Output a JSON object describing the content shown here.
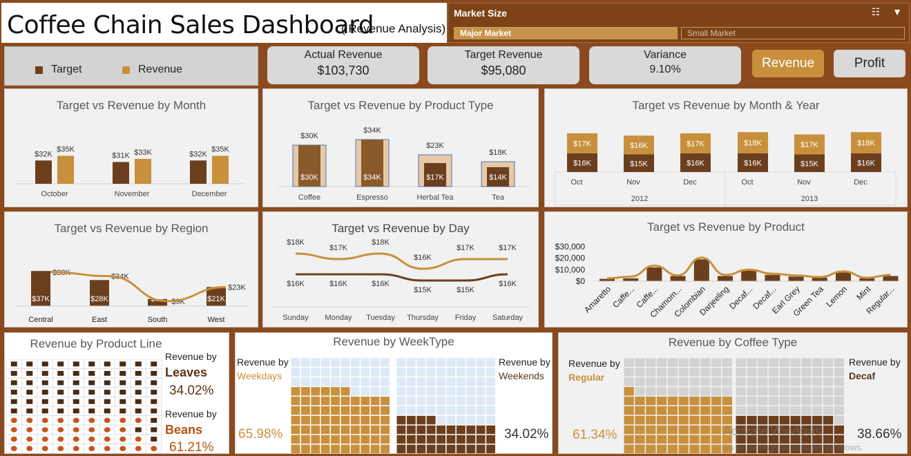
{
  "header": {
    "title": "Coffee Chain Sales Dashboard",
    "subtitle": "( Revenue Analysis)"
  },
  "slicer": {
    "title": "Market Size",
    "options": [
      "Major Market",
      "Small Market"
    ],
    "selected": "Major Market"
  },
  "legend": {
    "target": "Target",
    "revenue": "Revenue"
  },
  "colors": {
    "target": "#6b3f1e",
    "revenue": "#c8903c",
    "frame": "#8a4a1e",
    "panel": "#f1f1f1",
    "empty": "#dde9f5"
  },
  "kpis": [
    {
      "label": "Actual Revenue",
      "value": "$103,730"
    },
    {
      "label": "Target Revenue",
      "value": "$95,080"
    },
    {
      "label": "Variance",
      "value": "9.10%"
    }
  ],
  "buttons": {
    "revenue": "Revenue",
    "profit": "Profit"
  },
  "chart_data": [
    {
      "id": "by_month",
      "type": "bar",
      "title": "Target vs Revenue by Month",
      "categories": [
        "October",
        "November",
        "December"
      ],
      "series": [
        {
          "name": "Target",
          "values": [
            32,
            31,
            32
          ],
          "labels": [
            "$32K",
            "$31K",
            "$32K"
          ]
        },
        {
          "name": "Revenue",
          "values": [
            35,
            33,
            35
          ],
          "labels": [
            "$35K",
            "$33K",
            "$35K"
          ]
        }
      ]
    },
    {
      "id": "by_product_type",
      "type": "bar",
      "title": "Target vs Revenue by Product Type",
      "categories": [
        "Coffee",
        "Espresso",
        "Herbal Tea",
        "Tea"
      ],
      "series": [
        {
          "name": "Target",
          "values": [
            30,
            34,
            17,
            14
          ],
          "labels": [
            "$30K",
            "$34K",
            "$17K",
            "$14K"
          ]
        },
        {
          "name": "Revenue",
          "values": [
            30,
            34,
            23,
            18
          ],
          "labels": [
            "$30K",
            "$34K",
            "$23K",
            "$18K"
          ]
        }
      ]
    },
    {
      "id": "by_month_year",
      "type": "bar",
      "title": "Target vs Revenue by Month & Year",
      "categories": [
        "Oct",
        "Nov",
        "Dec",
        "Oct",
        "Nov",
        "Dec"
      ],
      "groups": [
        "2012",
        "2013"
      ],
      "series": [
        {
          "name": "Target",
          "values": [
            16,
            15,
            16,
            16,
            15,
            16
          ],
          "labels": [
            "$16K",
            "$15K",
            "$16K",
            "$16K",
            "$15K",
            "$16K"
          ]
        },
        {
          "name": "Revenue",
          "values": [
            17,
            16,
            17,
            18,
            17,
            18
          ],
          "labels": [
            "$17K",
            "$16K",
            "$17K",
            "$18K",
            "$17K",
            "$18K"
          ]
        }
      ]
    },
    {
      "id": "by_region",
      "type": "bar",
      "title": "Target vs Revenue by Region",
      "categories": [
        "Central",
        "East",
        "South",
        "West"
      ],
      "series": [
        {
          "name": "Target",
          "values": [
            37,
            28,
            9,
            21
          ],
          "labels": [
            "$37K",
            "$28K",
            "$9K",
            "$21K"
          ]
        },
        {
          "name": "Revenue",
          "values": [
            38,
            34,
            9,
            23
          ],
          "labels": [
            "$38K",
            "$34K",
            "$9K",
            "$23K"
          ]
        }
      ]
    },
    {
      "id": "by_day",
      "type": "line",
      "title": "Target vs Revenue by Day",
      "categories": [
        "Sunday",
        "Monday",
        "Tuesday",
        "Thursday",
        "Friday",
        "Saturday"
      ],
      "series": [
        {
          "name": "Target",
          "values": [
            16,
            16,
            16,
            15,
            15,
            16
          ],
          "labels": [
            "$16K",
            "$16K",
            "$16K",
            "$15K",
            "$15K",
            "$16K"
          ]
        },
        {
          "name": "Revenue",
          "values": [
            18,
            17,
            18,
            16,
            17,
            17
          ],
          "labels": [
            "$18K",
            "$17K",
            "$18K",
            "$16K",
            "$17K",
            "$17K"
          ]
        }
      ]
    },
    {
      "id": "by_product",
      "type": "bar",
      "title": "Target vs Revenue by Product",
      "categories": [
        "Amaretto",
        "Caffe...",
        "Caffe...",
        "Chamom...",
        "Colombian",
        "Darjeeling",
        "Decaf...",
        "Decaf...",
        "Earl Grey",
        "Green Tea",
        "Lemon",
        "Mint",
        "Regular..."
      ],
      "yticks": [
        "$0",
        "$10,000",
        "$20,000",
        "$30,000"
      ],
      "ylim": [
        0,
        30000
      ],
      "series": [
        {
          "name": "Target",
          "values": [
            2000,
            2500,
            12000,
            4500,
            19000,
            4500,
            9500,
            5500,
            4000,
            3000,
            7500,
            2500,
            4500
          ]
        },
        {
          "name": "Revenue",
          "values": [
            2500,
            4000,
            13500,
            5000,
            20500,
            5500,
            10000,
            6500,
            5000,
            3500,
            8500,
            3000,
            5500
          ]
        }
      ]
    }
  ],
  "waffles": {
    "product_line": {
      "title": "Revenue by Product Line",
      "top": {
        "label": "Revenue by",
        "name": "Leaves",
        "pct": "34.02%"
      },
      "bottom": {
        "label": "Revenue by",
        "name": "Beans",
        "pct": "61.21%"
      }
    },
    "weektype": {
      "title": "Revenue by WeekType",
      "left": {
        "label": "Revenue by",
        "name": "Weekdays",
        "pct": "65.98%",
        "value": 65.98
      },
      "right": {
        "label": "Revenue by",
        "name": "Weekends",
        "pct": "34.02%",
        "value": 34.02
      }
    },
    "coffee_type": {
      "title": "Revenue by Coffee Type",
      "left": {
        "label": "Revenue by",
        "name": "Regular",
        "pct": "61.34%",
        "value": 61.34
      },
      "right": {
        "label": "Revenue by",
        "name": "Decaf",
        "pct": "38.66%",
        "value": 38.66
      }
    }
  },
  "watermark": {
    "line1": "Activate Windows",
    "line2": "Go to Settings to activate Windows."
  }
}
